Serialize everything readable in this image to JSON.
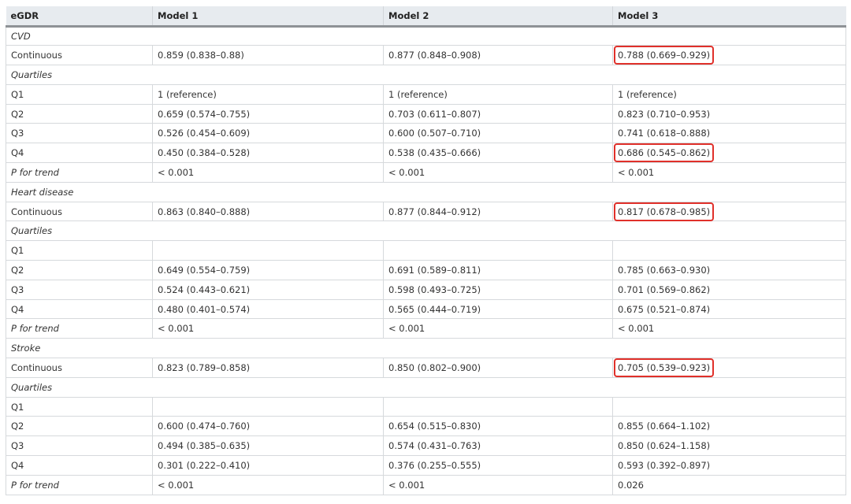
{
  "table": {
    "columns": [
      "eGDR",
      "Model 1",
      "Model 2",
      "Model 3"
    ],
    "rows": [
      {
        "type": "section",
        "label": "CVD"
      },
      {
        "type": "data",
        "label": "Continuous",
        "values": [
          "0.859 (0.838–0.88)",
          "0.877 (0.848–0.908)",
          "0.788 (0.669–0.929)"
        ],
        "highlight": [
          false,
          false,
          true
        ]
      },
      {
        "type": "section",
        "label": "Quartiles"
      },
      {
        "type": "data",
        "label": "Q1",
        "values": [
          "1 (reference)",
          "1 (reference)",
          "1 (reference)"
        ],
        "highlight": [
          false,
          false,
          false
        ]
      },
      {
        "type": "data",
        "label": "Q2",
        "values": [
          "0.659 (0.574–0.755)",
          "0.703 (0.611–0.807)",
          "0.823 (0.710–0.953)"
        ],
        "highlight": [
          false,
          false,
          false
        ]
      },
      {
        "type": "data",
        "label": "Q3",
        "values": [
          "0.526 (0.454–0.609)",
          "0.600 (0.507–0.710)",
          "0.741 (0.618–0.888)"
        ],
        "highlight": [
          false,
          false,
          false
        ]
      },
      {
        "type": "data",
        "label": "Q4",
        "values": [
          "0.450 (0.384–0.528)",
          "0.538 (0.435–0.666)",
          "0.686 (0.545–0.862)"
        ],
        "highlight": [
          false,
          false,
          true
        ]
      },
      {
        "type": "data",
        "label": "P for trend",
        "italic_label": true,
        "values": [
          "< 0.001",
          "< 0.001",
          "< 0.001"
        ],
        "highlight": [
          false,
          false,
          false
        ]
      },
      {
        "type": "section",
        "label": "Heart disease"
      },
      {
        "type": "data",
        "label": "Continuous",
        "values": [
          "0.863 (0.840–0.888)",
          "0.877 (0.844–0.912)",
          "0.817 (0.678–0.985)"
        ],
        "highlight": [
          false,
          false,
          true
        ]
      },
      {
        "type": "section",
        "label": "Quartiles"
      },
      {
        "type": "data",
        "label": "Q1",
        "values": [
          "",
          "",
          ""
        ],
        "highlight": [
          false,
          false,
          false
        ]
      },
      {
        "type": "data",
        "label": "Q2",
        "values": [
          "0.649 (0.554–0.759)",
          "0.691 (0.589–0.811)",
          "0.785 (0.663–0.930)"
        ],
        "highlight": [
          false,
          false,
          false
        ]
      },
      {
        "type": "data",
        "label": "Q3",
        "values": [
          "0.524 (0.443–0.621)",
          "0.598 (0.493–0.725)",
          "0.701 (0.569–0.862)"
        ],
        "highlight": [
          false,
          false,
          false
        ]
      },
      {
        "type": "data",
        "label": "Q4",
        "values": [
          "0.480 (0.401–0.574)",
          "0.565 (0.444–0.719)",
          "0.675 (0.521–0.874)"
        ],
        "highlight": [
          false,
          false,
          false
        ]
      },
      {
        "type": "data",
        "label": "P for trend",
        "italic_label": true,
        "values": [
          "< 0.001",
          "< 0.001",
          "< 0.001"
        ],
        "highlight": [
          false,
          false,
          false
        ]
      },
      {
        "type": "section",
        "label": "Stroke"
      },
      {
        "type": "data",
        "label": "Continuous",
        "values": [
          "0.823 (0.789–0.858)",
          "0.850 (0.802–0.900)",
          "0.705 (0.539–0.923)"
        ],
        "highlight": [
          false,
          false,
          true
        ]
      },
      {
        "type": "section",
        "label": "Quartiles"
      },
      {
        "type": "data",
        "label": "Q1",
        "values": [
          "",
          "",
          ""
        ],
        "highlight": [
          false,
          false,
          false
        ]
      },
      {
        "type": "data",
        "label": "Q2",
        "values": [
          "0.600 (0.474–0.760)",
          "0.654 (0.515–0.830)",
          "0.855 (0.664–1.102)"
        ],
        "highlight": [
          false,
          false,
          false
        ]
      },
      {
        "type": "data",
        "label": "Q3",
        "values": [
          "0.494 (0.385–0.635)",
          "0.574 (0.431–0.763)",
          "0.850 (0.624–1.158)"
        ],
        "highlight": [
          false,
          false,
          false
        ]
      },
      {
        "type": "data",
        "label": "Q4",
        "values": [
          "0.301 (0.222–0.410)",
          "0.376 (0.255–0.555)",
          "0.593 (0.392–0.897)"
        ],
        "highlight": [
          false,
          false,
          false
        ]
      },
      {
        "type": "data",
        "label": "P for trend",
        "italic_label": true,
        "values": [
          "< 0.001",
          "< 0.001",
          "0.026"
        ],
        "highlight": [
          false,
          false,
          false
        ]
      }
    ]
  },
  "colors": {
    "header_bg": "#e7ebef",
    "highlight_box": "#e0302a",
    "grid": "#d6d9dc",
    "text": "#333333"
  }
}
